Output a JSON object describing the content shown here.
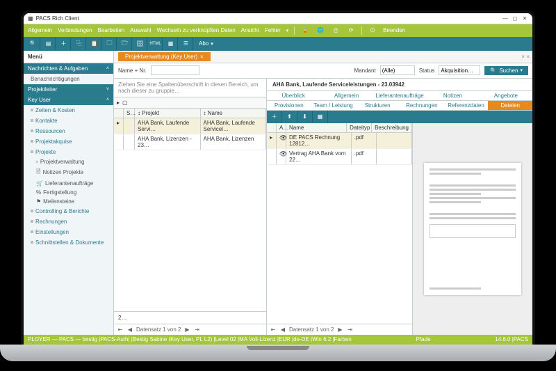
{
  "window": {
    "title": "PACS Rich Client"
  },
  "menubar": {
    "items": [
      "Allgemein",
      "Verbindungen",
      "Bearbeiten",
      "Auswahl",
      "Wechseln zu verknüpften Daten",
      "Ansicht",
      "Fehler"
    ],
    "right_label": "Beenden"
  },
  "sidebar": {
    "title": "Menü",
    "groups": [
      {
        "label": "Nachrichten & Aufgaben",
        "items": [
          "Benachrichtigungen"
        ]
      },
      {
        "label": "Projektleiter",
        "items": []
      },
      {
        "label": "Key User",
        "links": [
          "Zeiten & Kosten",
          "Kontakte",
          "Ressourcen",
          "Projektakquise",
          "Projekte"
        ],
        "sub": [
          "Projektverwaltung",
          "Notizen Projekte",
          "Lieferantenaufträge",
          "Fertigstellung",
          "Meilensteine"
        ],
        "links2": [
          "Controlling & Berichte",
          "Rechnungen",
          "Einstellungen",
          "Schnittstellen & Dokumente"
        ]
      }
    ]
  },
  "tab": {
    "label": "Projektverwaltung (Key User)"
  },
  "filter": {
    "name_label": "Name + Nr.",
    "mandant_label": "Mandant",
    "mandant_value": "(Alle)",
    "status_label": "Status",
    "status_value": "Akquisition…",
    "search": "Suchen"
  },
  "grid": {
    "hint": "Ziehen Sie eine Spaltenüberschrift in diesen Bereich, um nach dieser zu gruppie…",
    "cols": [
      "S…",
      "Projekt",
      "Name"
    ],
    "rows": [
      {
        "p": "AHA Bank, Laufende Servi…",
        "n": "AHA Bank, Laufende Servicel…"
      },
      {
        "p": "AHA Bank, Lizenzen - 23…",
        "n": "AHA Bank, Lizenzen"
      }
    ],
    "pager": "Datensatz 1 von 2",
    "page": "2…"
  },
  "detail": {
    "title": "AHA Bank, Laufende Serviceleistungen - 23.03942",
    "tabs1": [
      "Überblick",
      "Allgemein",
      "Lieferantenaufträge",
      "Notizen",
      "Angebote"
    ],
    "tabs2": [
      "Provisionen",
      "Team / Leistung",
      "Strukturen",
      "Rechnungen",
      "Referenzdaten",
      "Dateien"
    ],
    "docs": {
      "cols": [
        "A…",
        "Name",
        "Dateityp",
        "Beschreibung"
      ],
      "rows": [
        {
          "n": "DE PACS Rechnung 12812…",
          "t": ".pdf"
        },
        {
          "n": "Vertrag AHA Bank vom 22…",
          "t": ".pdf"
        }
      ],
      "pager": "Datensatz 1 von 2"
    }
  },
  "status": {
    "left": "PLOYER — PACS — bestig  |PACS-Auth|  |Bestig Sabine (Key User, PL L2)  |Level 02  |MA Voll-Lizenz  |EUR  |de-DE  |Win 6.2  |Farben",
    "mid": "Pfade",
    "right": "14.6.0  |PACS"
  },
  "chart_data": null
}
